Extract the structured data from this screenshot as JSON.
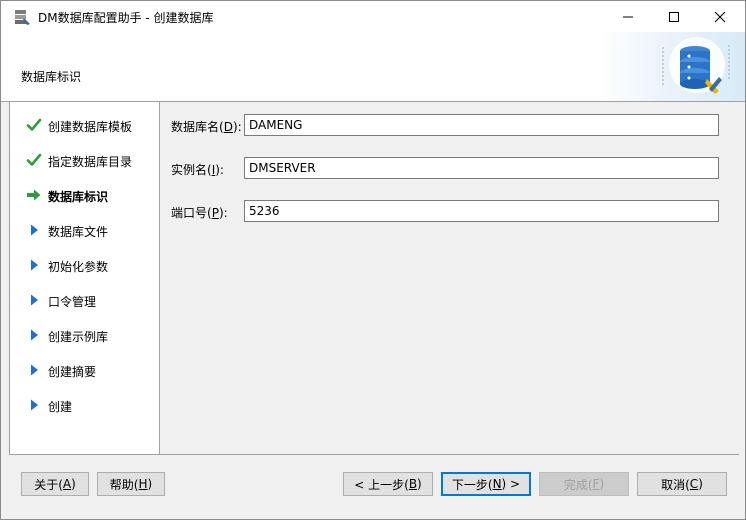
{
  "window": {
    "title": "DM数据库配置助手 - 创建数据库"
  },
  "header": {
    "title": "数据库标识"
  },
  "nav": {
    "items": [
      {
        "label": "创建数据库模板",
        "state": "done"
      },
      {
        "label": "指定数据库目录",
        "state": "done"
      },
      {
        "label": "数据库标识",
        "state": "current"
      },
      {
        "label": "数据库文件",
        "state": "pending"
      },
      {
        "label": "初始化参数",
        "state": "pending"
      },
      {
        "label": "口令管理",
        "state": "pending"
      },
      {
        "label": "创建示例库",
        "state": "pending"
      },
      {
        "label": "创建摘要",
        "state": "pending"
      },
      {
        "label": "创建",
        "state": "pending"
      }
    ]
  },
  "form": {
    "db_name": {
      "label_pre": "数据库名(",
      "key": "D",
      "label_post": "):",
      "value": "DAMENG"
    },
    "instance_name": {
      "label_pre": "实例名(",
      "key": "I",
      "label_post": "):",
      "value": "DMSERVER"
    },
    "port": {
      "label_pre": "端口号(",
      "key": "P",
      "label_post": "):",
      "value": "5236"
    }
  },
  "buttons": {
    "about": {
      "pre": "关于(",
      "key": "A",
      "post": ")"
    },
    "help": {
      "pre": "帮助(",
      "key": "H",
      "post": ")"
    },
    "prev": {
      "pre": "< 上一步(",
      "key": "B",
      "post": ")"
    },
    "next": {
      "pre": "下一步(",
      "key": "N",
      "post": ") >"
    },
    "finish": {
      "pre": "完成(",
      "key": "F",
      "post": ")"
    },
    "cancel": {
      "pre": "取消(",
      "key": "C",
      "post": ")"
    }
  },
  "colors": {
    "check_green": "#2e9e3a",
    "arrow_green": "#2e9e3a",
    "arrow_blue": "#1e6fcf"
  }
}
